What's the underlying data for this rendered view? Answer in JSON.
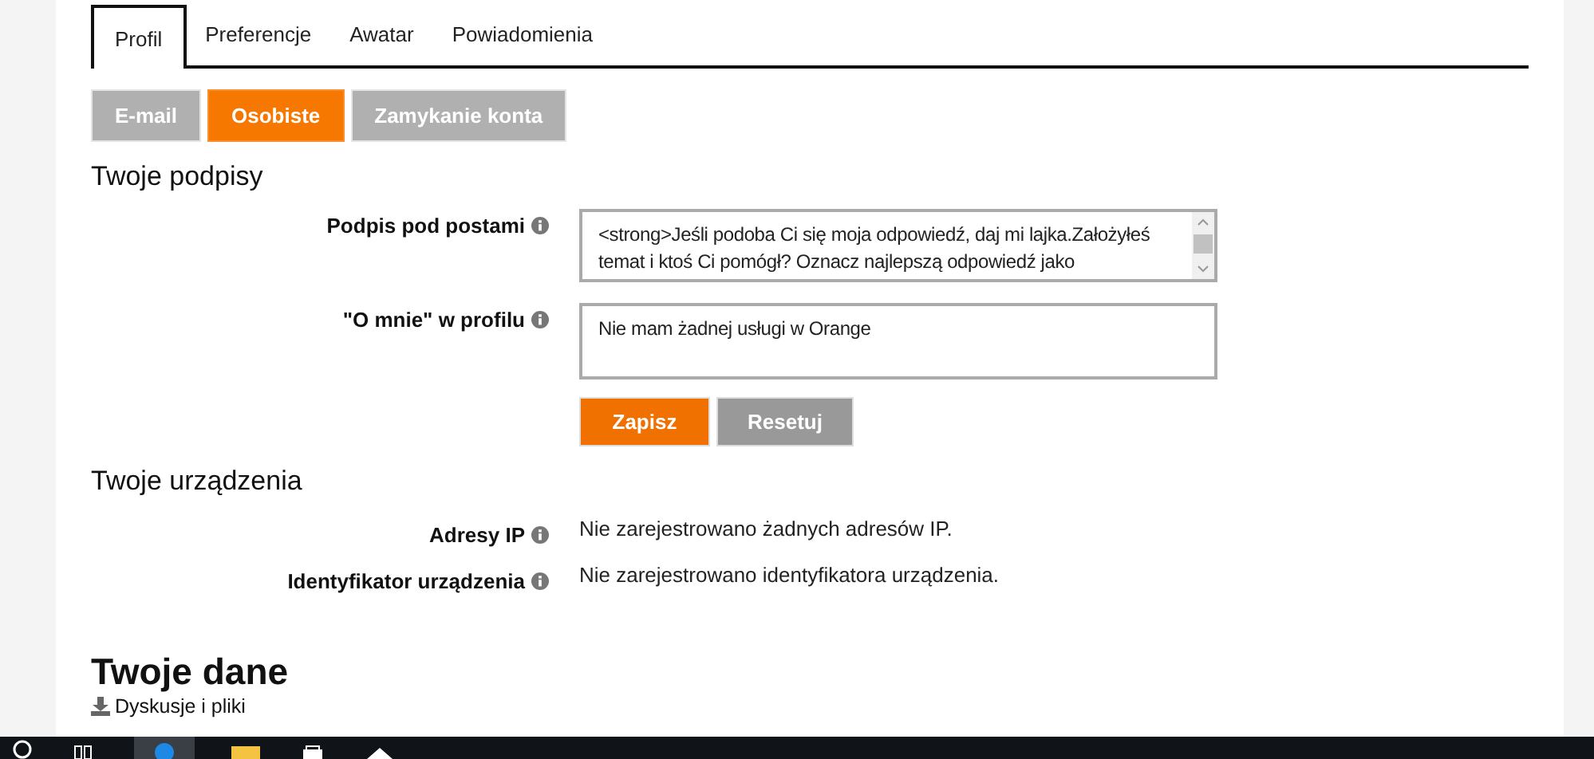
{
  "tabs": [
    {
      "label": "Profil",
      "selected": true
    },
    {
      "label": "Preferencje",
      "selected": false
    },
    {
      "label": "Awatar",
      "selected": false
    },
    {
      "label": "Powiadomienia",
      "selected": false
    }
  ],
  "subtabs": [
    {
      "label": "E-mail",
      "selected": false
    },
    {
      "label": "Osobiste",
      "selected": true
    },
    {
      "label": "Zamykanie konta",
      "selected": false
    }
  ],
  "signatures": {
    "heading": "Twoje podpisy",
    "fields": [
      {
        "label": "Podpis pod postami",
        "value": "<strong>Jeśli podoba Ci się moja odpowiedź, daj mi lajka.Założyłeś temat i ktoś Ci pomógł? Oznacz najlepszą odpowiedź jako",
        "scrollable": true
      },
      {
        "label": "\"O mnie\" w profilu",
        "value": "Nie mam żadnej usługi w Orange",
        "scrollable": false
      }
    ],
    "buttons": [
      {
        "label": "Zapisz",
        "kind": "primary"
      },
      {
        "label": "Resetuj",
        "kind": "secondary"
      }
    ]
  },
  "devices": {
    "heading": "Twoje urządzenia",
    "rows": [
      {
        "label": "Adresy IP",
        "value": "Nie zarejestrowano żadnych adresów IP."
      },
      {
        "label": "Identyfikator urządzenia",
        "value": "Nie zarejestrowano identyfikatora urządzenia."
      }
    ]
  },
  "data_section": {
    "heading": "Twoje dane",
    "link": "Dyskusje i pliki"
  }
}
